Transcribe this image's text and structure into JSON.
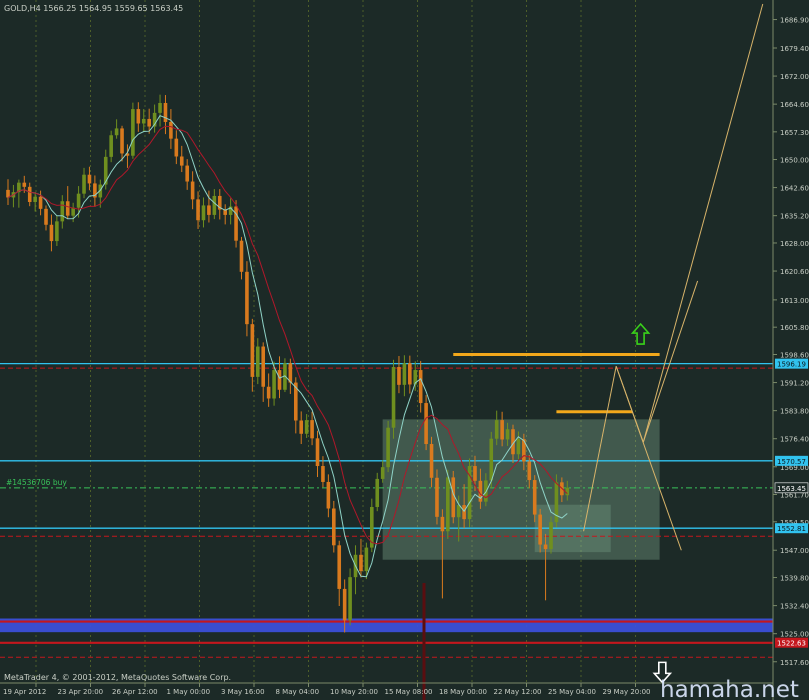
{
  "header": {
    "text": "GOLD,H4  1566.25  1564.95  1559.65  1563.45"
  },
  "footer": {
    "copyright": "MetaTrader 4, © 2001-2012, MetaQuotes Software Corp.",
    "watermark": "hamaha.net"
  },
  "order_label": "#14536706 buy",
  "colors": {
    "background": "#1c2a27",
    "grid": "#5a6b2a",
    "bull_candle": "#6f8f1f",
    "bear_candle": "#d97a1e",
    "ma_fast": "#8fd3c7",
    "ma_slow": "#b0182a",
    "hline_cyan": "#31c3ef",
    "hline_red": "#c4171d",
    "support_blue": "#3b4fd8",
    "zone_fill": "#8fbfa0",
    "trend_line": "#d8b46a",
    "arrow_up": "#39d21a",
    "arrow_down": "#ffffff",
    "order_line": "#39c25a"
  },
  "chart_data": {
    "type": "candlestick",
    "symbol": "GOLD",
    "timeframe": "H4",
    "ohlc_latest": {
      "open": 1566.25,
      "high": 1564.95,
      "low": 1559.65,
      "close": 1563.45
    },
    "ylim": [
      1512,
      1691
    ],
    "yticks": [
      "1686.90",
      "1679.40",
      "1672.00",
      "1664.60",
      "1657.30",
      "1650.00",
      "1642.60",
      "1635.20",
      "1628.00",
      "1620.60",
      "1613.00",
      "1605.80",
      "1598.60",
      "1591.20",
      "1583.80",
      "1576.40",
      "1569.00",
      "1561.70",
      "1554.50",
      "1547.00",
      "1539.80",
      "1532.40",
      "1525.00",
      "1517.60"
    ],
    "xticks": [
      "19 Apr 2012",
      "23 Apr 20:00",
      "26 Apr 12:00",
      "1 May 00:00",
      "3 May 16:00",
      "8 May 04:00",
      "10 May 20:00",
      "15 May 08:00",
      "18 May 00:00",
      "22 May 12:00",
      "25 May 04:00",
      "29 May 20:00"
    ],
    "price_labels": [
      {
        "value": 1596.19,
        "text": "1596.19",
        "style": "cyan"
      },
      {
        "value": 1570.57,
        "text": "1570.57",
        "style": "cyan"
      },
      {
        "value": 1563.45,
        "text": "1563.45",
        "style": "current"
      },
      {
        "value": 1552.81,
        "text": "1552.81",
        "style": "cyan"
      },
      {
        "value": 1522.63,
        "text": "1522.63",
        "style": "red"
      }
    ],
    "horizontal_lines": [
      {
        "value": 1596.19,
        "style": "cyan"
      },
      {
        "value": 1595.0,
        "style": "red-dash"
      },
      {
        "value": 1570.57,
        "style": "cyan"
      },
      {
        "value": 1563.45,
        "style": "green-dash"
      },
      {
        "value": 1552.81,
        "style": "cyan"
      },
      {
        "value": 1550.7,
        "style": "red-dash"
      },
      {
        "value": 1528.2,
        "style": "red"
      },
      {
        "value": 1522.6,
        "style": "red"
      },
      {
        "value": 1518.8,
        "style": "red-dash"
      }
    ],
    "support_band": [
      1525.4,
      1529.0
    ],
    "zone": {
      "x_from": 69,
      "x_to": 120,
      "price_from": 1544.5,
      "price_to": 1581.5
    },
    "inner_zone": {
      "x_from": 97,
      "x_to": 111,
      "price_from": 1546.5,
      "price_to": 1559.0
    },
    "resistance_marks": [
      {
        "x_from": 82,
        "x_to": 120,
        "price": 1598.6
      },
      {
        "x_from": 101,
        "x_to": 115,
        "price": 1583.5
      }
    ],
    "projection_lines": [
      {
        "from": [
          106,
          1552.0
        ],
        "to": [
          112,
          1595.5
        ]
      },
      {
        "from": [
          112,
          1595.5
        ],
        "to": [
          117,
          1575.5
        ]
      },
      {
        "from": [
          117,
          1575.5
        ],
        "to": [
          139,
          1691.0
        ]
      },
      {
        "from": [
          112,
          1595.5
        ],
        "to": [
          124,
          1547.0
        ]
      },
      {
        "from": [
          117,
          1575.5
        ],
        "to": [
          127,
          1618.0
        ]
      }
    ],
    "arrows": [
      {
        "type": "up",
        "x": 116.5,
        "price": 1604.0
      },
      {
        "type": "down",
        "x": 120.5,
        "price": 1514.8
      }
    ],
    "candles": [
      [
        1642.0,
        1644.8,
        1638.0,
        1640.0
      ],
      [
        1640.0,
        1643.3,
        1637.4,
        1641.4
      ],
      [
        1641.4,
        1644.7,
        1637.3,
        1643.9
      ],
      [
        1643.9,
        1645.7,
        1641.2,
        1642.8
      ],
      [
        1642.8,
        1643.9,
        1637.7,
        1638.8
      ],
      [
        1638.8,
        1641.4,
        1636.3,
        1640.2
      ],
      [
        1640.2,
        1641.8,
        1635.3,
        1637.0
      ],
      [
        1637.0,
        1637.9,
        1631.3,
        1632.8
      ],
      [
        1632.8,
        1635.5,
        1625.8,
        1628.5
      ],
      [
        1628.5,
        1635.2,
        1627.2,
        1633.7
      ],
      [
        1633.7,
        1640.6,
        1631.8,
        1639.0
      ],
      [
        1639.0,
        1643.0,
        1634.3,
        1635.2
      ],
      [
        1635.2,
        1638.6,
        1633.5,
        1637.3
      ],
      [
        1637.3,
        1643.0,
        1634.7,
        1641.0
      ],
      [
        1641.0,
        1647.8,
        1639.8,
        1646.0
      ],
      [
        1646.0,
        1648.1,
        1641.9,
        1643.7
      ],
      [
        1643.7,
        1645.8,
        1637.5,
        1640.0
      ],
      [
        1640.0,
        1644.7,
        1637.3,
        1643.4
      ],
      [
        1643.4,
        1652.6,
        1642.1,
        1650.7
      ],
      [
        1650.7,
        1657.6,
        1649.3,
        1656.4
      ],
      [
        1656.4,
        1660.6,
        1655.5,
        1658.2
      ],
      [
        1658.2,
        1658.9,
        1649.5,
        1651.6
      ],
      [
        1651.6,
        1654.0,
        1647.8,
        1651.0
      ],
      [
        1651.0,
        1665.0,
        1650.2,
        1663.3
      ],
      [
        1663.3,
        1665.1,
        1657.3,
        1659.5
      ],
      [
        1659.5,
        1663.3,
        1657.4,
        1660.7
      ],
      [
        1660.7,
        1663.4,
        1656.8,
        1658.7
      ],
      [
        1658.7,
        1664.5,
        1657.1,
        1662.3
      ],
      [
        1662.3,
        1667.1,
        1658.7,
        1664.9
      ],
      [
        1664.9,
        1667.0,
        1656.7,
        1659.9
      ],
      [
        1659.9,
        1663.3,
        1652.8,
        1655.5
      ],
      [
        1655.5,
        1657.7,
        1648.8,
        1650.8
      ],
      [
        1650.8,
        1653.6,
        1646.7,
        1648.4
      ],
      [
        1648.4,
        1650.1,
        1642.0,
        1644.2
      ],
      [
        1644.2,
        1646.9,
        1636.9,
        1639.5
      ],
      [
        1639.5,
        1641.6,
        1631.7,
        1634.0
      ],
      [
        1634.0,
        1640.0,
        1632.1,
        1637.9
      ],
      [
        1637.9,
        1641.8,
        1633.4,
        1635.4
      ],
      [
        1635.4,
        1642.2,
        1634.3,
        1640.4
      ],
      [
        1640.4,
        1642.2,
        1634.2,
        1636.8
      ],
      [
        1636.8,
        1638.2,
        1632.9,
        1635.4
      ],
      [
        1635.4,
        1639.8,
        1632.9,
        1637.6
      ],
      [
        1637.6,
        1639.3,
        1626.8,
        1628.6
      ],
      [
        1628.6,
        1629.6,
        1618.4,
        1620.4
      ],
      [
        1620.4,
        1623.2,
        1603.4,
        1606.6
      ],
      [
        1606.6,
        1608.0,
        1588.8,
        1592.7
      ],
      [
        1592.7,
        1602.9,
        1590.8,
        1600.7
      ],
      [
        1600.7,
        1601.8,
        1586.1,
        1590.1
      ],
      [
        1590.1,
        1593.6,
        1584.8,
        1587.0
      ],
      [
        1587.0,
        1596.7,
        1585.1,
        1594.5
      ],
      [
        1594.5,
        1598.1,
        1587.1,
        1589.3
      ],
      [
        1589.3,
        1597.6,
        1588.7,
        1596.3
      ],
      [
        1596.3,
        1597.5,
        1588.2,
        1591.2
      ],
      [
        1591.2,
        1592.6,
        1577.8,
        1581.2
      ],
      [
        1581.2,
        1583.6,
        1575.0,
        1577.7
      ],
      [
        1577.7,
        1582.9,
        1576.6,
        1581.3
      ],
      [
        1581.3,
        1583.5,
        1574.7,
        1576.5
      ],
      [
        1576.5,
        1578.5,
        1566.3,
        1569.2
      ],
      [
        1569.2,
        1571.8,
        1563.6,
        1565.0
      ],
      [
        1565.0,
        1567.0,
        1555.7,
        1558.0
      ],
      [
        1558.0,
        1560.0,
        1546.4,
        1548.3
      ],
      [
        1548.3,
        1549.5,
        1532.3,
        1536.8
      ],
      [
        1536.8,
        1539.3,
        1525.3,
        1528.5
      ],
      [
        1528.5,
        1542.2,
        1527.2,
        1539.9
      ],
      [
        1539.9,
        1548.3,
        1535.4,
        1545.8
      ],
      [
        1545.8,
        1550.0,
        1539.8,
        1541.5
      ],
      [
        1541.5,
        1549.0,
        1539.4,
        1547.7
      ],
      [
        1547.7,
        1560.6,
        1546.5,
        1558.4
      ],
      [
        1558.4,
        1567.4,
        1557.3,
        1565.8
      ],
      [
        1565.8,
        1570.7,
        1564.8,
        1568.9
      ],
      [
        1568.9,
        1581.1,
        1567.6,
        1579.3
      ],
      [
        1579.3,
        1597.2,
        1576.4,
        1595.3
      ],
      [
        1595.3,
        1598.2,
        1588.4,
        1590.6
      ],
      [
        1590.6,
        1598.4,
        1587.6,
        1596.3
      ],
      [
        1596.3,
        1598.3,
        1588.3,
        1590.7
      ],
      [
        1590.7,
        1596.8,
        1589.0,
        1594.5
      ],
      [
        1594.5,
        1596.9,
        1583.3,
        1585.8
      ],
      [
        1585.8,
        1587.9,
        1573.4,
        1575.0
      ],
      [
        1575.0,
        1576.9,
        1563.6,
        1566.1
      ],
      [
        1566.1,
        1568.3,
        1553.8,
        1555.8
      ],
      [
        1555.8,
        1557.8,
        1534.3,
        1552.0
      ],
      [
        1552.0,
        1568.2,
        1550.0,
        1566.2
      ],
      [
        1566.2,
        1567.9,
        1554.1,
        1555.7
      ],
      [
        1555.7,
        1561.4,
        1549.3,
        1558.9
      ],
      [
        1558.9,
        1564.4,
        1552.8,
        1555.2
      ],
      [
        1555.2,
        1571.2,
        1553.1,
        1569.2
      ],
      [
        1569.2,
        1571.9,
        1562.6,
        1565.3
      ],
      [
        1565.3,
        1568.5,
        1557.9,
        1559.8
      ],
      [
        1559.8,
        1567.3,
        1558.6,
        1565.4
      ],
      [
        1565.4,
        1578.2,
        1563.3,
        1576.4
      ],
      [
        1576.4,
        1583.8,
        1574.7,
        1581.3
      ],
      [
        1581.3,
        1583.5,
        1574.4,
        1576.2
      ],
      [
        1576.2,
        1580.6,
        1574.5,
        1578.9
      ],
      [
        1578.9,
        1580.1,
        1570.0,
        1572.3
      ],
      [
        1572.3,
        1578.3,
        1571.0,
        1576.3
      ],
      [
        1576.3,
        1577.7,
        1568.1,
        1570.4
      ],
      [
        1570.4,
        1572.1,
        1563.3,
        1565.5
      ],
      [
        1565.5,
        1566.8,
        1554.4,
        1556.4
      ],
      [
        1556.4,
        1557.9,
        1546.4,
        1548.5
      ],
      [
        1548.5,
        1551.3,
        1533.8,
        1547.3
      ],
      [
        1547.3,
        1555.9,
        1546.1,
        1554.4
      ],
      [
        1554.4,
        1567.0,
        1553.0,
        1564.9
      ],
      [
        1564.9,
        1566.2,
        1559.7,
        1561.5
      ],
      [
        1561.5,
        1565.3,
        1560.1,
        1563.5
      ]
    ]
  }
}
